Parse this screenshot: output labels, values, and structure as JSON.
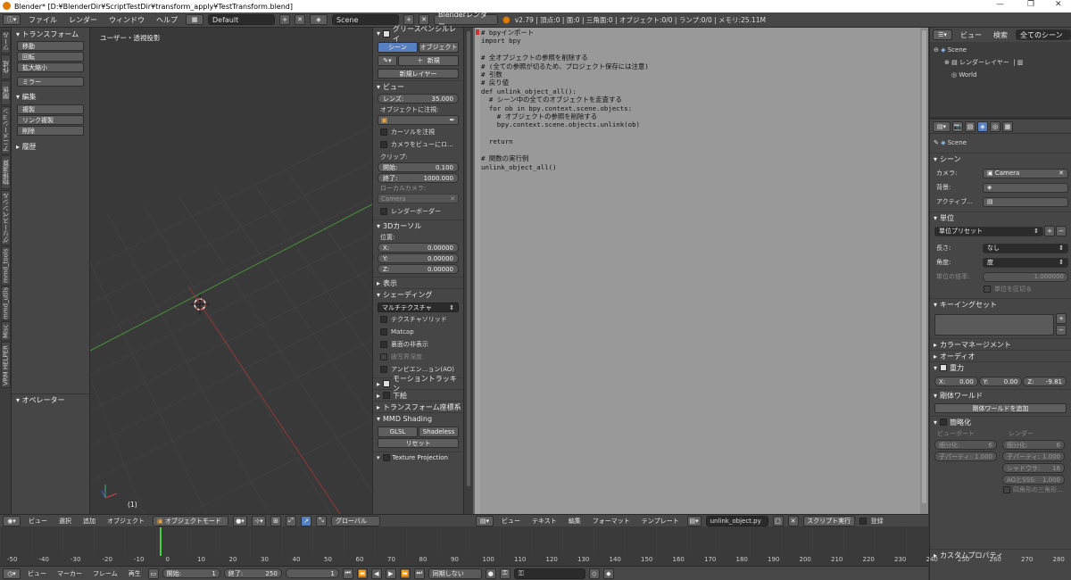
{
  "title_bar": {
    "title": "Blender* [D:¥BlenderDir¥ScriptTestDir¥transform_apply¥TestTransform.blend]",
    "minimize": "—",
    "maximize": "❐",
    "close": "✕"
  },
  "main_header": {
    "menus": [
      "ファイル",
      "レンダー",
      "ウィンドウ",
      "ヘルプ"
    ],
    "layout": "Default",
    "scene": "Scene",
    "engine": "Blenderレンダー",
    "stats": "v2.79 | 頂点:0 | 面:0 | 三角面:0 | オブジェクト:0/0 | ランプ:0/0 | メモリ:25.11M"
  },
  "left_tabs": [
    "ツール",
    "作成",
    "関係",
    "アニメーション",
    "物理演算",
    "グリースペンシル",
    "mmd_tools",
    "mmd_utils",
    "Misc",
    "VRM HELPER"
  ],
  "toolshelf": {
    "transform_header": "トランスフォーム",
    "transform_buttons": [
      "移動",
      "回転",
      "拡大縮小"
    ],
    "mirror_button": "ミラー",
    "edit_header": "編集",
    "edit_buttons": [
      "複製",
      "リンク複製",
      "削除"
    ],
    "history_header": "履歴",
    "operator_header": "オペレーター"
  },
  "viewport": {
    "label": "ユーザー・透視投影",
    "frame": "(1)"
  },
  "npanel": {
    "grease_header": "グリースペンシルレイ",
    "tab_scene": "シーン",
    "tab_object": "オブジェクト",
    "new_button": "新規",
    "new_layer_button": "新規レイヤー",
    "view_header": "ビュー",
    "lens_label": "レンズ:",
    "lens_value": "35.000",
    "lock_label": "オブジェクトに注視:",
    "cursor_lock": "カーソルを注視",
    "camera_to_view": "カメラをビューにロ...",
    "clip_label": "クリップ:",
    "clip_start_label": "開始:",
    "clip_start_value": "0.100",
    "clip_end_label": "終了:",
    "clip_end_value": "1000.000",
    "local_camera_label": "ローカルカメラ:",
    "local_camera_value": "Camera",
    "render_border": "レンダーボーダー",
    "cursor_header": "3Dカーソル",
    "location_label": "位置:",
    "cursor_x_label": "X:",
    "cursor_x": "0.00000",
    "cursor_y_label": "Y:",
    "cursor_y": "0.00000",
    "cursor_z_label": "Z:",
    "cursor_z": "0.00000",
    "display_header": "表示",
    "shading_header": "シェーディング",
    "shading_mode": "マルチテクスチャ",
    "textured_solid": "テクスチャソリッド",
    "matcap": "Matcap",
    "backface": "裏面の非表示",
    "depth_of_field": "被写界深度",
    "ambient_occlusion": "アンビエン...ョン(AO)",
    "motion_tracking": "モーショントラッキン",
    "background_images": "下絵",
    "transform_orient": "トランスフォーム座標系",
    "mmd_shading": "MMD Shading",
    "glsl": "GLSL",
    "shadeless": "Shadeless",
    "reset": "リセット",
    "texture_projection": "Texture Projection"
  },
  "text_editor": {
    "code": "# bpyインポート\nimport bpy\n\n# 全オブジェクトの参照を削除する\n# (全ての参照が切るため、プロジェクト保存には注意)\n# 引数\n# 戻り値\ndef unlink_object_all():\n  # シーン中の全てのオブジェクトを走査する\n  for ob in bpy.context.scene.objects:\n    # オブジェクトの参照を削除する\n    bpy.context.scene.objects.unlink(ob)\n\n  return\n\n# 関数の実行例\nunlink_object_all()",
    "menus": [
      "ビュー",
      "テキスト",
      "編集",
      "フォーマット",
      "テンプレート"
    ],
    "file_name": "unlink_object.py",
    "run_script": "スクリプト実行",
    "register": "登録"
  },
  "viewport_header": {
    "menus": [
      "ビュー",
      "選択",
      "追加",
      "オブジェクト"
    ],
    "mode": "オブジェクトモード",
    "orientation": "グローバル"
  },
  "outliner": {
    "menus": [
      "ビュー",
      "検索"
    ],
    "filter": "全てのシーン",
    "items": [
      "Scene",
      "レンダーレイヤー",
      "World"
    ]
  },
  "rprops": {
    "scene_label": "Scene",
    "scene_header": "シーン",
    "camera_label": "カメラ:",
    "camera_value": "Camera",
    "background_label": "背景:",
    "active_label": "アクティブ...",
    "units_header": "単位",
    "unit_presets": "単位プリセット",
    "length_label": "長さ:",
    "length_value": "なし",
    "angle_label": "角度:",
    "angle_value": "度",
    "unit_scale_label": "単位の倍率:",
    "unit_scale_value": "1.000000",
    "separate_units": "単位を区切る",
    "keying_header": "キーイングセット",
    "color_mgmt": "カラーマネージメント",
    "audio": "オーディオ",
    "gravity": "重力",
    "gx_label": "X:",
    "gx": "0.00",
    "gy_label": "Y:",
    "gy": "0.00",
    "gz_label": "Z:",
    "gz": "-9.81",
    "rigid_world": "剛体ワールド",
    "add_rigid_world": "剛体ワールドを追加",
    "simplify": "簡略化",
    "viewport_col": "ビューポート",
    "render_col": "レンダー",
    "subdiv_label": "細分化:",
    "subdiv_v": "6",
    "subdiv_r": "6",
    "child_label": "子パーティ:",
    "child_v": "1.000",
    "child_r": "1.000",
    "shadow_label": "シャドウサ:",
    "shadow_r": "16",
    "ao_label": "AOとSSS:",
    "ao_r": "1.000",
    "tri_label": "四角形の三角形...",
    "custom_props": "カスタムプロパティ"
  },
  "timeline": {
    "ruler_ticks": [
      "-50",
      "-40",
      "-30",
      "-20",
      "-10",
      "0",
      "10",
      "20",
      "30",
      "40",
      "50",
      "60",
      "70",
      "80",
      "90",
      "100",
      "110",
      "120",
      "130",
      "140",
      "150",
      "160",
      "170",
      "180",
      "190",
      "200",
      "210",
      "220",
      "230",
      "240",
      "250",
      "260",
      "270",
      "280"
    ],
    "menus": [
      "ビュー",
      "マーカー",
      "フレーム",
      "再生"
    ],
    "start_label": "開始:",
    "start_value": "1",
    "end_label": "終了:",
    "end_value": "250",
    "current_frame": "1",
    "sync": "同期しない"
  },
  "colors": {
    "grid_x_axis": "#8a3a3a",
    "grid_y_axis": "#3f8a3f",
    "playhead": "#4cd13c",
    "text_bg": "#999999"
  }
}
